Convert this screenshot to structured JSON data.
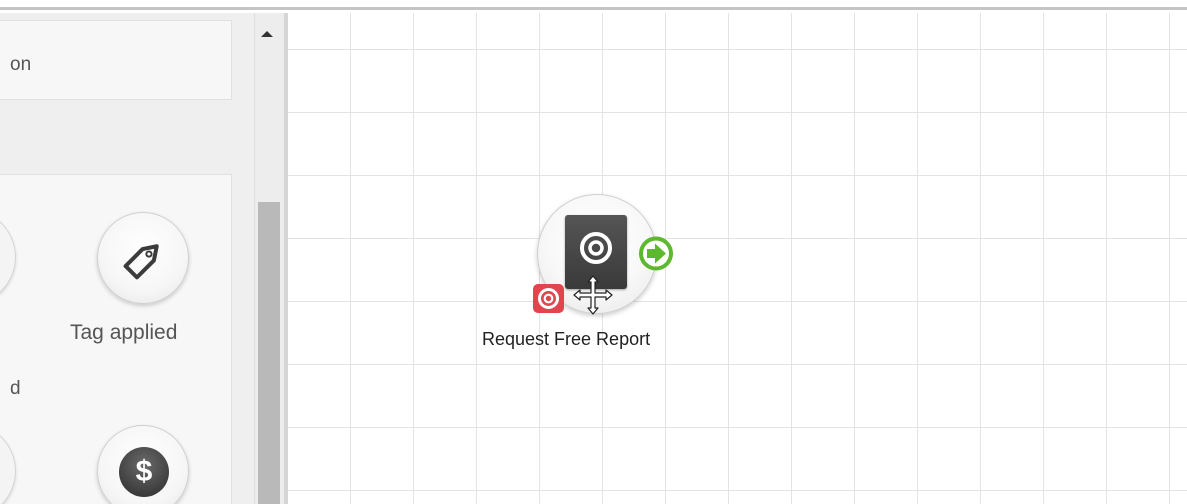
{
  "sidebar": {
    "top_card_label": "on",
    "partial_item_label": "d",
    "tools": [
      {
        "label": "Tag applied",
        "icon": "tag-icon"
      },
      {
        "label": "",
        "icon": "dollar-icon",
        "glyph": "$"
      }
    ]
  },
  "canvas": {
    "node": {
      "label": "Request Free Report",
      "icon": "target-icon",
      "badge_icon": "target-badge-icon",
      "connector_icon": "arrow-right-circle-icon",
      "cursor_icon": "move-cursor-icon"
    }
  },
  "colors": {
    "badge_red": "#e2454d",
    "connector_green": "#5cb82c",
    "node_dark": "#3f3f3f"
  }
}
